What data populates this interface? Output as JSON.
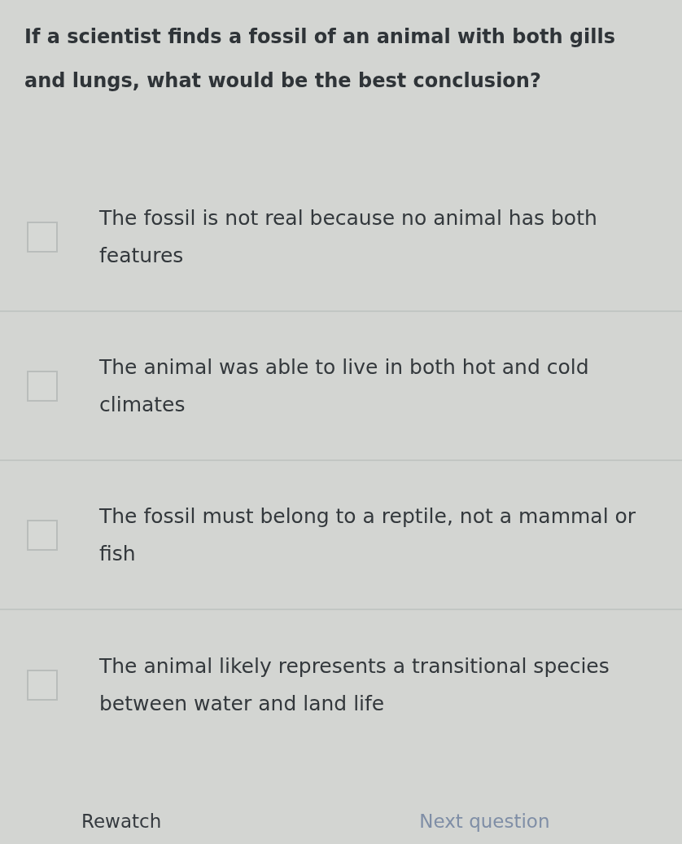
{
  "question": "If a scientist finds a fossil of an animal with both gills and lungs, what would be the best conclusion?",
  "options": [
    {
      "text": "The fossil is not real because no animal has both features",
      "checked": false
    },
    {
      "text": "The animal was able to live in both hot and cold climates",
      "checked": false
    },
    {
      "text": "The fossil must belong to a reptile, not a mammal or fish",
      "checked": false
    },
    {
      "text": "The animal likely represents a transitional species between water and land life",
      "checked": false
    }
  ],
  "buttons": [
    {
      "label": "Rewatch",
      "disabled": false
    },
    {
      "label": "Next question",
      "disabled": true
    }
  ]
}
